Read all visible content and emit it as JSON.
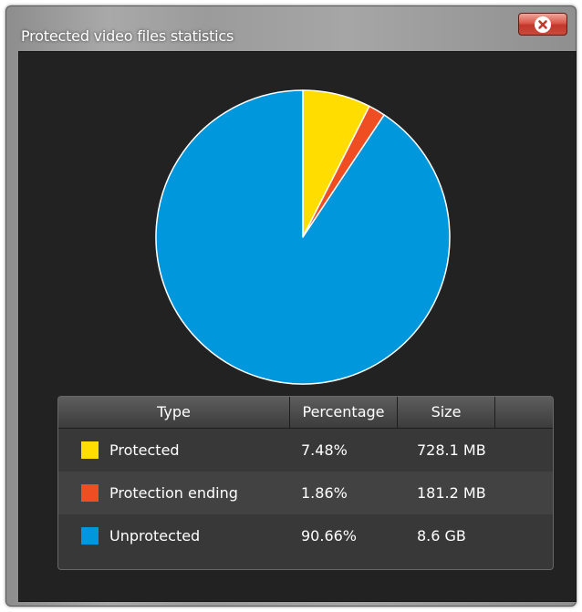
{
  "window": {
    "title": "Protected video files statistics"
  },
  "colors": {
    "protected": "#ffdd00",
    "protection_ending": "#ef4e23",
    "unprotected": "#0097dd",
    "panel_background": "#222222"
  },
  "icons": {
    "close": "close-x-icon"
  },
  "table": {
    "headers": [
      "Type",
      "Percentage",
      "Size"
    ],
    "rows": [
      {
        "type": "Protected",
        "percentage": "7.48%",
        "size": "728.1 MB",
        "color": "#ffdd00"
      },
      {
        "type": "Protection ending",
        "percentage": "1.86%",
        "size": "181.2 MB",
        "color": "#ef4e23"
      },
      {
        "type": "Unprotected",
        "percentage": "90.66%",
        "size": "8.6 GB",
        "color": "#0097dd"
      }
    ]
  },
  "chart_data": {
    "type": "pie",
    "categories": [
      "Protected",
      "Protection ending",
      "Unprotected"
    ],
    "values": [
      7.48,
      1.86,
      90.66
    ],
    "colors": [
      "#ffdd00",
      "#ef4e23",
      "#0097dd"
    ],
    "start_angle": "top",
    "direction": "clockwise"
  }
}
